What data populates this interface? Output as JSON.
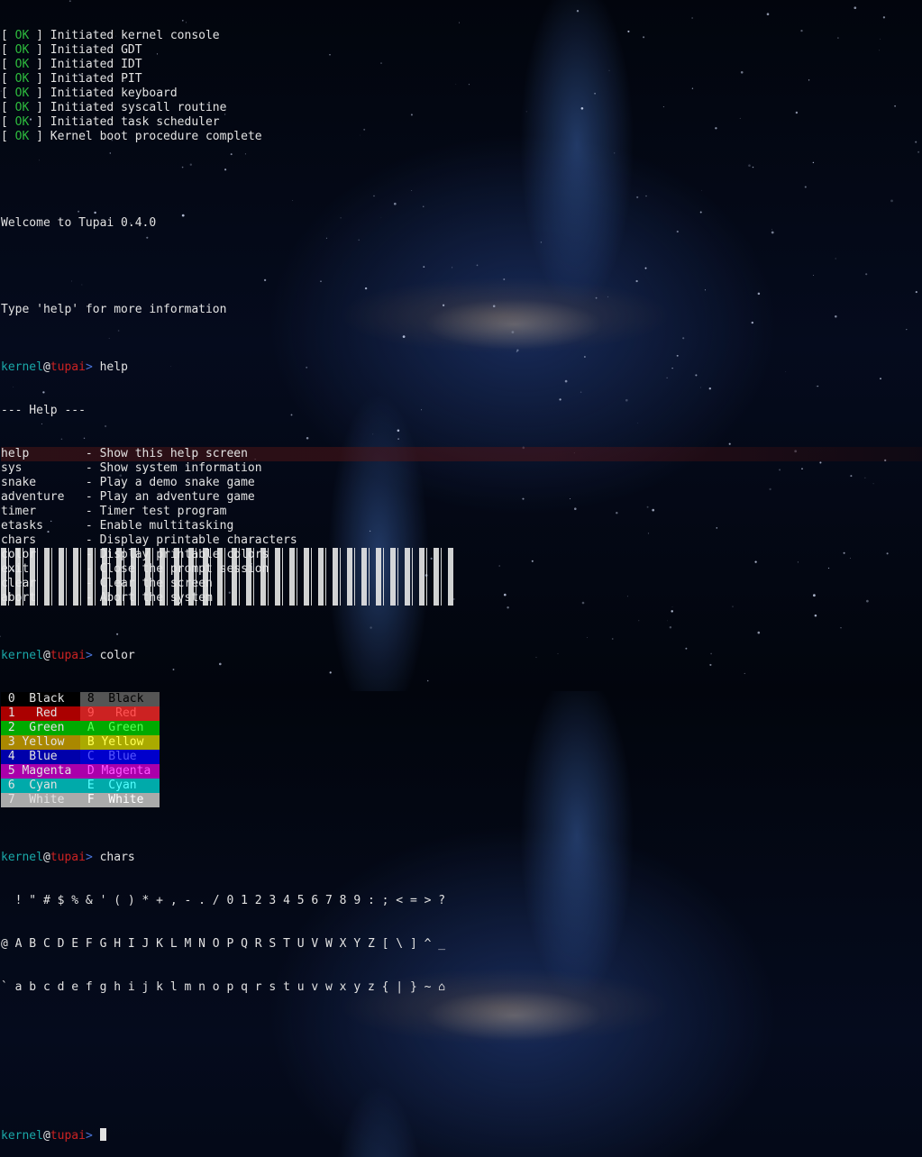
{
  "boot": [
    {
      "status": "OK",
      "text": "Initiated kernel console"
    },
    {
      "status": "OK",
      "text": "Initiated GDT"
    },
    {
      "status": "OK",
      "text": "Initiated IDT"
    },
    {
      "status": "OK",
      "text": "Initiated PIT"
    },
    {
      "status": "OK",
      "text": "Initiated keyboard"
    },
    {
      "status": "OK",
      "text": "Initiated syscall routine"
    },
    {
      "status": "OK",
      "text": "Initiated task scheduler"
    },
    {
      "status": "OK",
      "text": "Kernel boot procedure complete"
    }
  ],
  "welcome": "Welcome to Tupai 0.4.0",
  "hint": "Type 'help' for more information",
  "prompt": {
    "user": "kernel",
    "at": "@",
    "host": "tupai",
    "sym": ">"
  },
  "commands": {
    "help": "help",
    "color": "color",
    "chars": "chars"
  },
  "help_header": "--- Help ---",
  "help_items": [
    {
      "cmd": "help",
      "desc": "- Show this help screen"
    },
    {
      "cmd": "sys",
      "desc": "- Show system information"
    },
    {
      "cmd": "snake",
      "desc": "- Play a demo snake game"
    },
    {
      "cmd": "adventure",
      "desc": "- Play an adventure game"
    },
    {
      "cmd": "timer",
      "desc": "- Timer test program"
    },
    {
      "cmd": "etasks",
      "desc": "- Enable multitasking"
    },
    {
      "cmd": "chars",
      "desc": "- Display printable characters"
    },
    {
      "cmd": "color",
      "desc": "- Display printable colors"
    },
    {
      "cmd": "exit",
      "desc": "- Close the prompt session"
    },
    {
      "cmd": "clear",
      "desc": "- Clear the screen"
    },
    {
      "cmd": "abort",
      "desc": "- Abort the system"
    }
  ],
  "colors": [
    {
      "left": " 0  Black",
      "left_bg": "#000000",
      "left_fg": "#e2e2e2",
      "right": " 8  Black",
      "right_bg": "#555555",
      "right_fg": "#000000"
    },
    {
      "left": " 1   Red",
      "left_bg": "#aa0000",
      "left_fg": "#e2e2e2",
      "right": " 9   Red",
      "right_bg": "#cc2222",
      "right_fg": "#ff5555"
    },
    {
      "left": " 2  Green",
      "left_bg": "#00aa00",
      "left_fg": "#e2e2e2",
      "right": " A  Green",
      "right_bg": "#00aa00",
      "right_fg": "#55ff55"
    },
    {
      "left": " 3 Yellow",
      "left_bg": "#aa8800",
      "left_fg": "#e2e2e2",
      "right": " B Yellow",
      "right_bg": "#aaaa00",
      "right_fg": "#ffff55"
    },
    {
      "left": " 4  Blue",
      "left_bg": "#0000aa",
      "left_fg": "#e2e2e2",
      "right": " C  Blue",
      "right_bg": "#0000cc",
      "right_fg": "#5555ff"
    },
    {
      "left": " 5 Magenta",
      "left_bg": "#aa00aa",
      "left_fg": "#e2e2e2",
      "right": " D Magenta",
      "right_bg": "#aa00aa",
      "right_fg": "#ff55ff"
    },
    {
      "left": " 6  Cyan",
      "left_bg": "#00aaaa",
      "left_fg": "#e2e2e2",
      "right": " E  Cyan",
      "right_bg": "#00aaaa",
      "right_fg": "#55ffff"
    },
    {
      "left": " 7  White",
      "left_bg": "#aaaaaa",
      "left_fg": "#e2e2e2",
      "right": " F  White",
      "right_bg": "#aaaaaa",
      "right_fg": "#ffffff"
    }
  ],
  "chars_rows": [
    "  ! \" # $ % & ' ( ) * + , - . / 0 1 2 3 4 5 6 7 8 9 : ; < = > ?",
    "@ A B C D E F G H I J K L M N O P Q R S T U V W X Y Z [ \\ ] ^ _",
    "` a b c d e f g h i j k l m n o p q r s t u v w x y z { | } ~ ⌂"
  ]
}
